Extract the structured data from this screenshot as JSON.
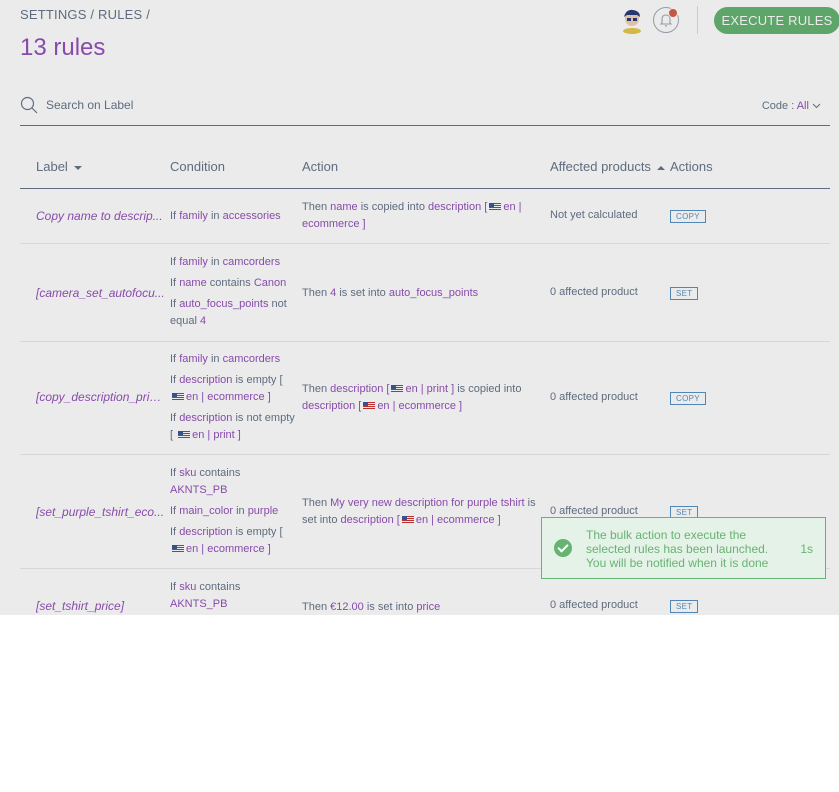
{
  "breadcrumb": {
    "settings": "Settings",
    "sep1": "/",
    "rules": "Rules",
    "sep2": "/"
  },
  "page_title": "13 rules",
  "header": {
    "execute_label": "EXECUTE RULES",
    "accent": "#67b373",
    "notification_dot": "#d4604f"
  },
  "search": {
    "placeholder": "Search on Label"
  },
  "code_filter": {
    "label": "Code :",
    "value": "All"
  },
  "columns": {
    "label": "Label",
    "condition": "Condition",
    "action": "Action",
    "affected": "Affected products",
    "actions": "Actions"
  },
  "rows": [
    {
      "label": "Copy name to descrip...",
      "conditions": [
        {
          "pre": "If",
          "field": "family",
          "op": "in",
          "value": "accessories"
        }
      ],
      "action": {
        "pre": "Then",
        "field": "name",
        "mid": "is copied into",
        "target": "description [",
        "scope": "en | ecommerce ]"
      },
      "affected": "Not yet calculated",
      "button": "Copy"
    },
    {
      "label": "[camera_set_autofocu...",
      "conditions": [
        {
          "pre": "If",
          "field": "family",
          "op": "in",
          "value": "camcorders"
        },
        {
          "pre": "If",
          "field": "name",
          "op": "contains",
          "value": "Canon"
        },
        {
          "pre": "If",
          "field": "auto_focus_points",
          "op": "not equal",
          "value": "4"
        }
      ],
      "action": {
        "pre": "Then",
        "value": "4",
        "mid": "is set into",
        "target": "auto_focus_points"
      },
      "affected": "0 affected product",
      "button": "Set"
    },
    {
      "label": "[copy_description_prin...",
      "conditions": [
        {
          "pre": "If",
          "field": "family",
          "op": "in",
          "value": "camcorders"
        },
        {
          "pre": "If",
          "field": "description",
          "op": "is empty [",
          "value": "en | ecommerce ]"
        },
        {
          "pre": "If",
          "field": "description",
          "op": "is not empty [",
          "value": "en | print ]"
        }
      ],
      "action": {
        "pre": "Then",
        "field": "description [",
        "scope": "en | print ]",
        "mid": "is copied into",
        "target": "description [",
        "scope2": "en | ecommerce ]"
      },
      "affected": "0 affected product",
      "button": "Copy"
    },
    {
      "label": "[set_purple_tshirt_eco...",
      "conditions": [
        {
          "pre": "If",
          "field": "sku",
          "op": "contains",
          "value": "AKNTS_PB"
        },
        {
          "pre": "If",
          "field": "main_color",
          "op": "in",
          "value": "purple"
        },
        {
          "pre": "If",
          "field": "description",
          "op": "is empty [",
          "value": "en | ecommerce ]"
        }
      ],
      "action": {
        "pre": "Then",
        "value": "My very new description for purple tshirt",
        "mid": "is set into",
        "target": "description [",
        "scope": "en | ecommerce ]"
      },
      "affected": "0 affected product",
      "button": "Set"
    },
    {
      "label": "[set_tshirt_price]",
      "conditions": [
        {
          "pre": "If",
          "field": "sku",
          "op": "contains",
          "value": "AKNTS_PB"
        }
      ],
      "action": {
        "pre": "Then",
        "value": "€12.00",
        "mid": "is set into",
        "target": "price"
      },
      "affected": "0 affected product",
      "button": "Set"
    }
  ],
  "toast": {
    "line1": "The bulk action to execute the",
    "line2": "selected rules has been launched.",
    "line3": "You will be notified when it is done",
    "time": "1s"
  }
}
